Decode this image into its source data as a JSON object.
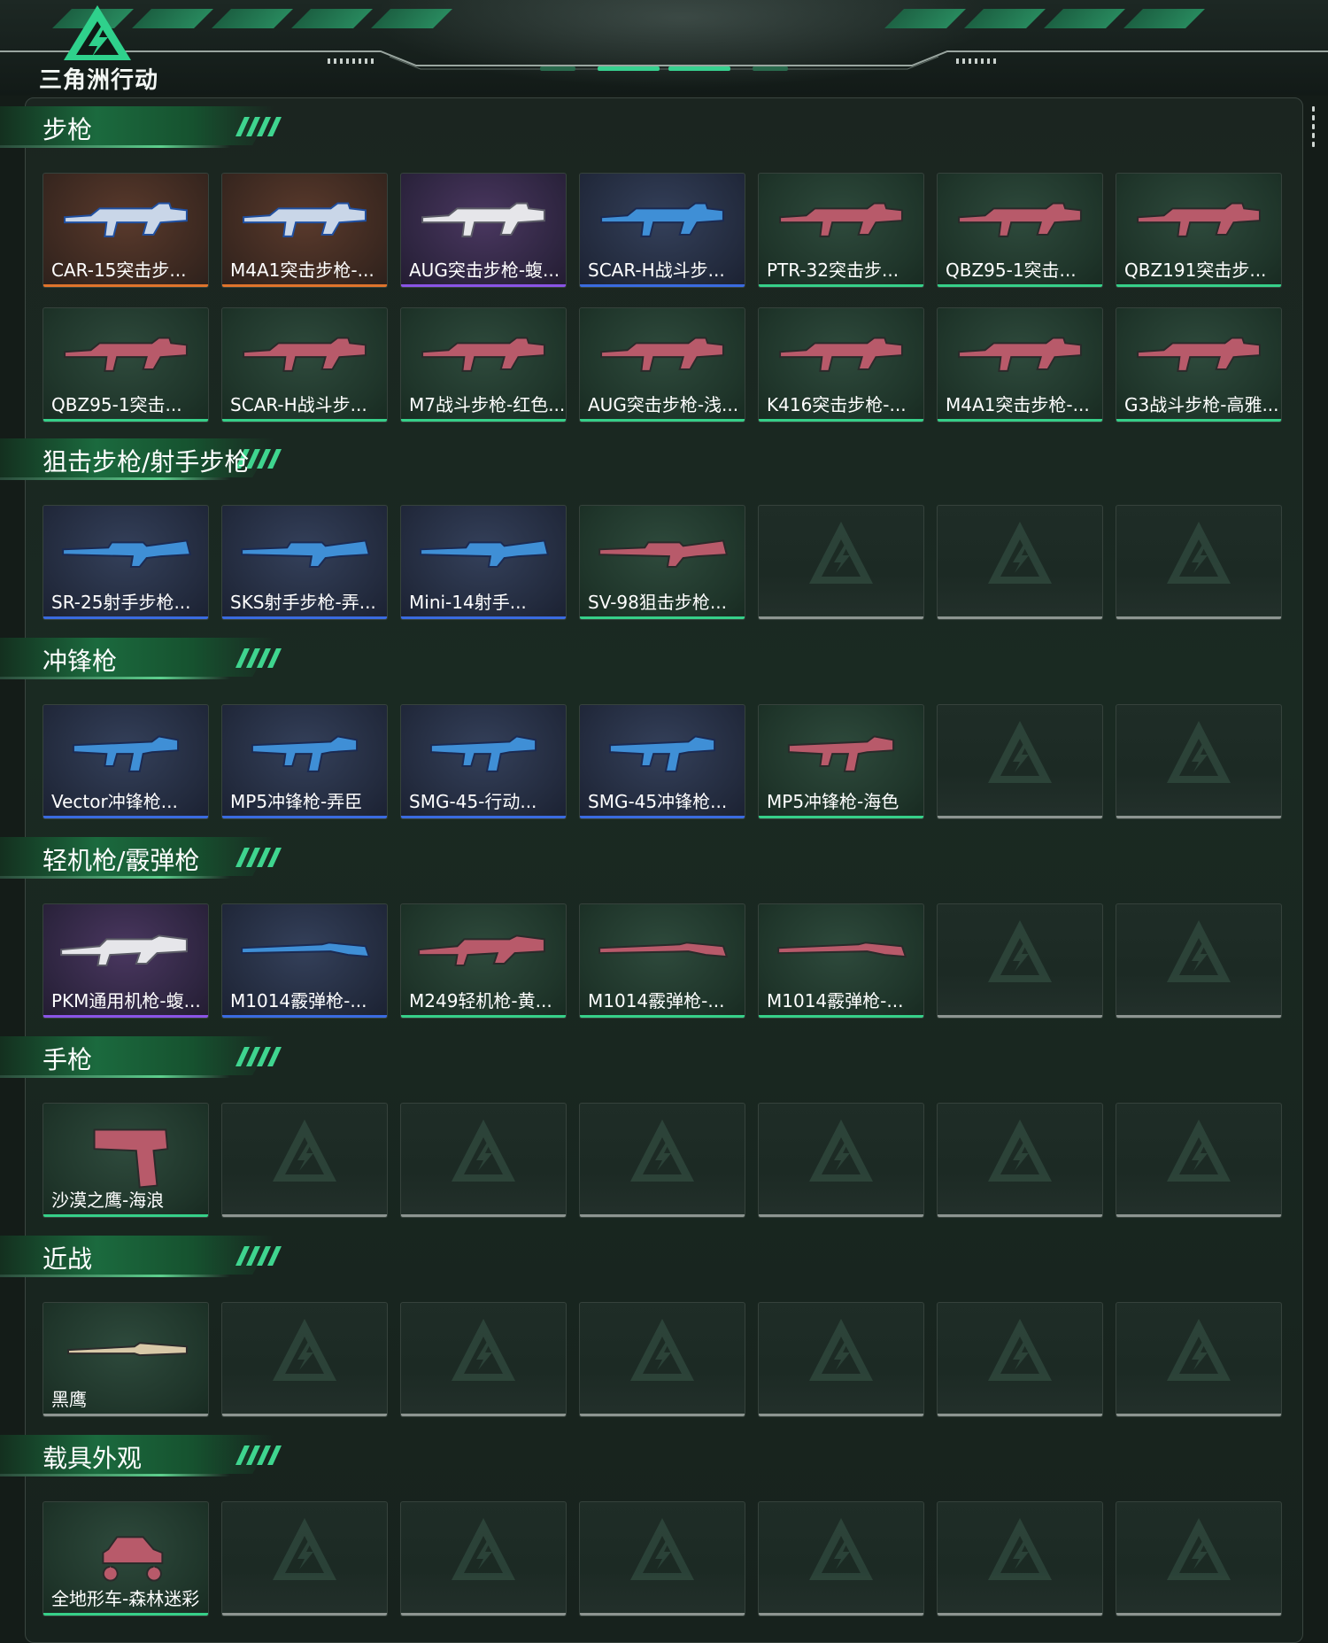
{
  "header": {
    "logo_text": "三角洲行动"
  },
  "colors": {
    "rarity_orange": "#e0742c",
    "rarity_purple": "#8a54e6",
    "rarity_blue": "#3a6be0",
    "rarity_green": "#36d089",
    "rarity_empty": "#8d9591",
    "accent": "#2fc98a"
  },
  "sections": [
    {
      "title": "步枪",
      "items": [
        {
          "name": "CAR-15突击步...",
          "rarity": "orange",
          "icon": "rifle-icon"
        },
        {
          "name": "M4A1突击步枪-...",
          "rarity": "orange",
          "icon": "rifle-icon"
        },
        {
          "name": "AUG突击步枪-蝮...",
          "rarity": "purple",
          "icon": "rifle-icon"
        },
        {
          "name": "SCAR-H战斗步...",
          "rarity": "blue",
          "icon": "rifle-icon"
        },
        {
          "name": "PTR-32突击步...",
          "rarity": "green",
          "icon": "rifle-icon"
        },
        {
          "name": "QBZ95-1突击...",
          "rarity": "green",
          "icon": "rifle-icon"
        },
        {
          "name": "QBZ191突击步...",
          "rarity": "green",
          "icon": "rifle-icon"
        },
        {
          "name": "QBZ95-1突击...",
          "rarity": "green",
          "icon": "rifle-icon"
        },
        {
          "name": "SCAR-H战斗步...",
          "rarity": "green",
          "icon": "rifle-icon"
        },
        {
          "name": "M7战斗步枪-红色...",
          "rarity": "green",
          "icon": "rifle-icon"
        },
        {
          "name": "AUG突击步枪-浅...",
          "rarity": "green",
          "icon": "rifle-icon"
        },
        {
          "name": "K416突击步枪-...",
          "rarity": "green",
          "icon": "rifle-icon"
        },
        {
          "name": "M4A1突击步枪-...",
          "rarity": "green",
          "icon": "rifle-icon"
        },
        {
          "name": "G3战斗步枪-高雅...",
          "rarity": "green",
          "icon": "rifle-icon"
        }
      ],
      "slots": 14
    },
    {
      "title": "狙击步枪/射手步枪",
      "items": [
        {
          "name": "SR-25射手步枪...",
          "rarity": "blue",
          "icon": "sniper-rifle-icon"
        },
        {
          "name": "SKS射手步枪-弄...",
          "rarity": "blue",
          "icon": "sniper-rifle-icon"
        },
        {
          "name": "Mini-14射手...",
          "rarity": "blue",
          "icon": "sniper-rifle-icon"
        },
        {
          "name": "SV-98狙击步枪...",
          "rarity": "green",
          "icon": "sniper-rifle-icon"
        }
      ],
      "slots": 7
    },
    {
      "title": "冲锋枪",
      "items": [
        {
          "name": "Vector冲锋枪...",
          "rarity": "blue",
          "icon": "smg-icon"
        },
        {
          "name": "MP5冲锋枪-弄臣",
          "rarity": "blue",
          "icon": "smg-icon"
        },
        {
          "name": "SMG-45-行动...",
          "rarity": "blue",
          "icon": "smg-icon"
        },
        {
          "name": "SMG-45冲锋枪...",
          "rarity": "blue",
          "icon": "smg-icon"
        },
        {
          "name": "MP5冲锋枪-海色",
          "rarity": "green",
          "icon": "smg-icon"
        }
      ],
      "slots": 7
    },
    {
      "title": "轻机枪/霰弹枪",
      "items": [
        {
          "name": "PKM通用机枪-蝮...",
          "rarity": "purple",
          "icon": "machine-gun-icon"
        },
        {
          "name": "M1014霰弹枪-...",
          "rarity": "blue",
          "icon": "shotgun-icon"
        },
        {
          "name": "M249轻机枪-黄...",
          "rarity": "green",
          "icon": "machine-gun-icon"
        },
        {
          "name": "M1014霰弹枪-...",
          "rarity": "green",
          "icon": "shotgun-icon"
        },
        {
          "name": "M1014霰弹枪-...",
          "rarity": "green",
          "icon": "shotgun-icon"
        }
      ],
      "slots": 7
    },
    {
      "title": "手枪",
      "items": [
        {
          "name": "沙漠之鹰-海浪",
          "rarity": "green",
          "icon": "pistol-icon"
        }
      ],
      "slots": 7
    },
    {
      "title": "近战",
      "items": [
        {
          "name": "黑鹰",
          "rarity": "empty",
          "icon": "knife-icon"
        }
      ],
      "slots": 7
    },
    {
      "title": "载具外观",
      "items": [
        {
          "name": "全地形车-森林迷彩",
          "rarity": "green",
          "icon": "atv-icon"
        }
      ],
      "slots": 7
    }
  ]
}
